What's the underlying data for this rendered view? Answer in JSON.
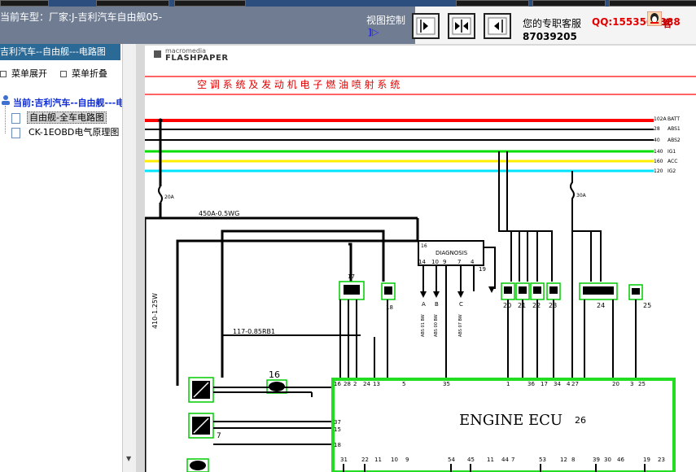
{
  "header": {
    "car_model": "当前车型：厂家:J-吉利汽车自由舰05-",
    "view_control_label": "视图控制",
    "view_control_glyph": "]▷",
    "support_label": "您的专职客服",
    "qq": "QQ:1553501388",
    "kefu": "客",
    "phone": "87039205"
  },
  "sidebar": {
    "title": "吉利汽车--自由舰---电路图",
    "expand_label": "菜单展开",
    "collapse_label": "菜单折叠",
    "tree_root": "当前:吉利汽车--自由舰---电路",
    "items": [
      {
        "label": "自由舰-全车电路图",
        "selected": true
      },
      {
        "label": "CK-1EOBD电气原理图",
        "selected": false
      }
    ]
  },
  "viewer": {
    "logo_top": "macromedia",
    "logo_bottom": "FLASHPAPER"
  },
  "diagram": {
    "title": "空 调 系 统 及 发 动 机 电 子 燃 油 喷 射 系 统",
    "power_lines": [
      {
        "code": "102A",
        "label": "BATT",
        "color": "#ff0000"
      },
      {
        "code": "28",
        "label": "ABS1",
        "color": "#000000"
      },
      {
        "code": "40",
        "label": "ABS2",
        "color": "#000000"
      },
      {
        "code": "140",
        "label": "IG1",
        "color": "#00dd00"
      },
      {
        "code": "160",
        "label": "ACC",
        "color": "#ffee00"
      },
      {
        "code": "120",
        "label": "IG2",
        "color": "#00e5ff"
      }
    ],
    "fuse_left": "20A",
    "fuse_right": "30A",
    "wire_450A": "450A-0.5WG",
    "wire_410": "410-1.25W",
    "wire_117": "117-0.85RB1",
    "diagnosis_label": "DIAGNOSIS",
    "diagnosis_id": "16",
    "diagnosis_pins": [
      "14",
      "10",
      "9",
      "7",
      "4"
    ],
    "diagnosis_pin_19": "19",
    "connector_ids": [
      "17",
      "18",
      "20",
      "21",
      "22",
      "23",
      "24",
      "25"
    ],
    "relay_ids": [
      "16",
      "7"
    ],
    "ecu_label": "ENGINE ECU",
    "ecu_id": "26",
    "ecu_left_pins": [
      "16",
      "28",
      "37",
      "15",
      "18"
    ],
    "ecu_top_pins": [
      "2",
      "24",
      "13",
      "5",
      "35",
      "1",
      "36",
      "17",
      "34",
      "4",
      "27",
      "20",
      "3",
      "25"
    ],
    "ecu_bottom_pins": [
      "31",
      "22",
      "11",
      "10",
      "9",
      "54",
      "45",
      "11",
      "44",
      "7",
      "53",
      "12",
      "8",
      "39",
      "30",
      "46",
      "19",
      "23"
    ],
    "diag_wires": [
      "A",
      "B",
      "C"
    ],
    "diag_wire_labels": [
      "ABS 01 BW",
      "ABS 00 BW",
      "ABS 07 BW"
    ]
  }
}
